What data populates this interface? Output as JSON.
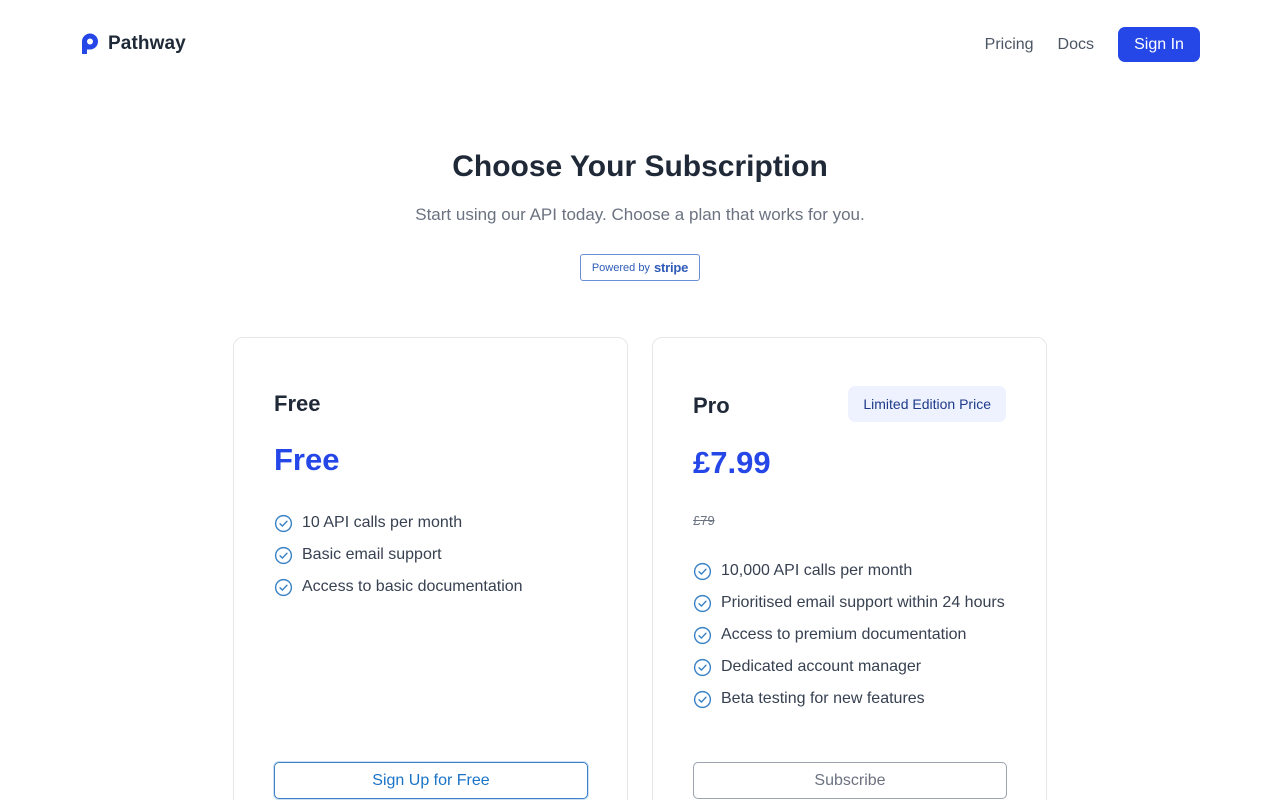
{
  "header": {
    "brand": "Pathway",
    "brand_icon": "pathway-logo-icon",
    "nav": {
      "pricing": "Pricing",
      "docs": "Docs",
      "sign_in": "Sign In"
    },
    "accent_color": "#2547e8"
  },
  "hero": {
    "title": "Choose Your Subscription",
    "subtitle": "Start using our API today. Choose a plan that works for you.",
    "powered_by": {
      "prefix": "Powered by",
      "brand": "stripe"
    }
  },
  "plans": [
    {
      "name": "Free",
      "price": "Free",
      "features": [
        "10 API calls per month",
        "Basic email support",
        "Access to basic documentation"
      ],
      "cta": "Sign Up for Free"
    },
    {
      "name": "Pro",
      "badge": "Limited Edition Price",
      "price": "£7.99",
      "original_price": "£79",
      "features": [
        "10,000 API calls per month",
        "Prioritised email support within 24 hours",
        "Access to premium documentation",
        "Dedicated account manager",
        "Beta testing for new features"
      ],
      "cta": "Subscribe"
    }
  ],
  "icons": {
    "feature_check": "check-circle-icon"
  }
}
